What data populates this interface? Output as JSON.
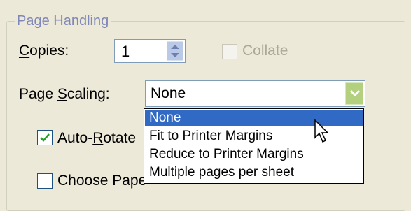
{
  "group": {
    "title": "Page Handling"
  },
  "copies": {
    "label_underlined": "C",
    "label_rest": "opies:",
    "value": "1"
  },
  "collate": {
    "label": "Collate",
    "checked": false,
    "disabled": true
  },
  "page_scaling": {
    "label_start": "Page ",
    "label_underlined": "S",
    "label_rest": "caling:",
    "value": "None",
    "options": [
      {
        "label": "None",
        "selected": true
      },
      {
        "label": "Fit to Printer Margins",
        "selected": false
      },
      {
        "label": "Reduce to Printer Margins",
        "selected": false
      },
      {
        "label": "Multiple pages per sheet",
        "selected": false
      }
    ]
  },
  "auto_rotate": {
    "label_start": "Auto-",
    "label_underlined": "R",
    "label_rest": "otate",
    "checked": true
  },
  "choose_paper": {
    "label": "Choose Pape",
    "checked": false
  },
  "colors": {
    "background": "#ece9d8",
    "selection": "#316ac5",
    "group_title": "#7f86b8"
  }
}
